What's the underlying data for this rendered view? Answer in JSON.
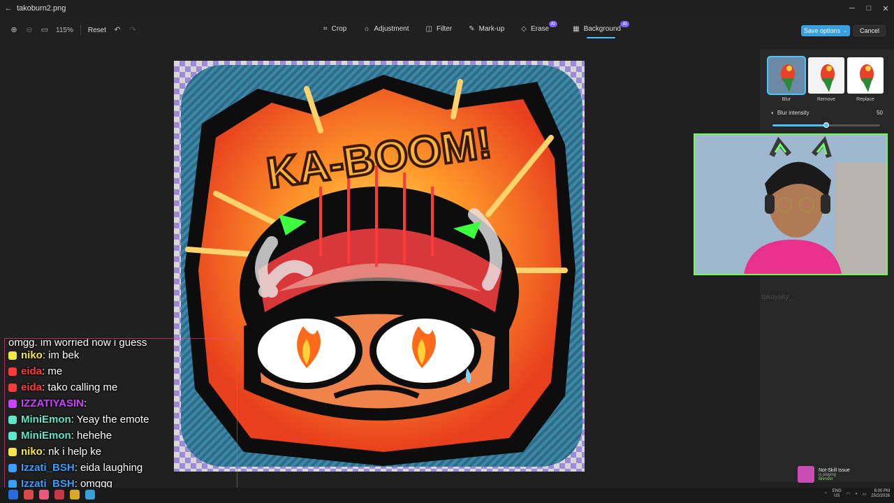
{
  "window": {
    "title": "takoburn2.png"
  },
  "toolbar": {
    "zoom": "115%",
    "reset": "Reset",
    "tools": [
      {
        "label": "Crop",
        "icon": "crop-icon",
        "ai": false
      },
      {
        "label": "Adjustment",
        "icon": "adjustment-icon",
        "ai": false
      },
      {
        "label": "Filter",
        "icon": "filter-icon",
        "ai": false
      },
      {
        "label": "Mark-up",
        "icon": "markup-icon",
        "ai": false
      },
      {
        "label": "Erase",
        "icon": "erase-icon",
        "ai": true
      },
      {
        "label": "Background",
        "icon": "background-icon",
        "ai": true,
        "active": true
      }
    ],
    "ai_badge": "AI",
    "save": "Save options",
    "cancel": "Cancel"
  },
  "canvas": {
    "headline": "KA-BOOM!"
  },
  "panel": {
    "options": [
      {
        "label": "Blur",
        "selected": true
      },
      {
        "label": "Remove",
        "selected": false
      },
      {
        "label": "Replace",
        "selected": false
      }
    ],
    "blur_label": "Blur intensity",
    "blur_value": "50",
    "blur_fraction": 0.5
  },
  "overlay": {
    "faded_name": "takoyaky_"
  },
  "chat": {
    "first_line": "omgg. im worried now i guess",
    "lines": [
      {
        "user": "niko",
        "message": ": im bek",
        "color": "#f5e64a"
      },
      {
        "user": "eida",
        "message": ": me",
        "color": "#ff3a3a"
      },
      {
        "user": "eida",
        "message": ": tako calling me",
        "color": "#ff3a3a"
      },
      {
        "user": "IZZATIYASIN",
        "message": ": ",
        "color": "#c944ff"
      },
      {
        "user": "MiniEmon",
        "message": ": Yeay the emote",
        "color": "#5ee6c6"
      },
      {
        "user": "MiniEmon",
        "message": ": hehehe",
        "color": "#5ee6c6"
      },
      {
        "user": "niko",
        "message": ": nk i help ke",
        "color": "#f5e64a"
      },
      {
        "user": "Izzati_BSH",
        "message": ": eida laughing",
        "color": "#3aa0ff"
      },
      {
        "user": "Izzati_BSH",
        "message": ": omggg",
        "color": "#3aa0ff"
      }
    ]
  },
  "notification": {
    "title": "Not-Skill Issue",
    "status": "is playing",
    "game": "Blender"
  },
  "tray": {
    "lang": "ENG",
    "region": "US",
    "time": "6:00 PM",
    "date": "25/2/2026"
  }
}
